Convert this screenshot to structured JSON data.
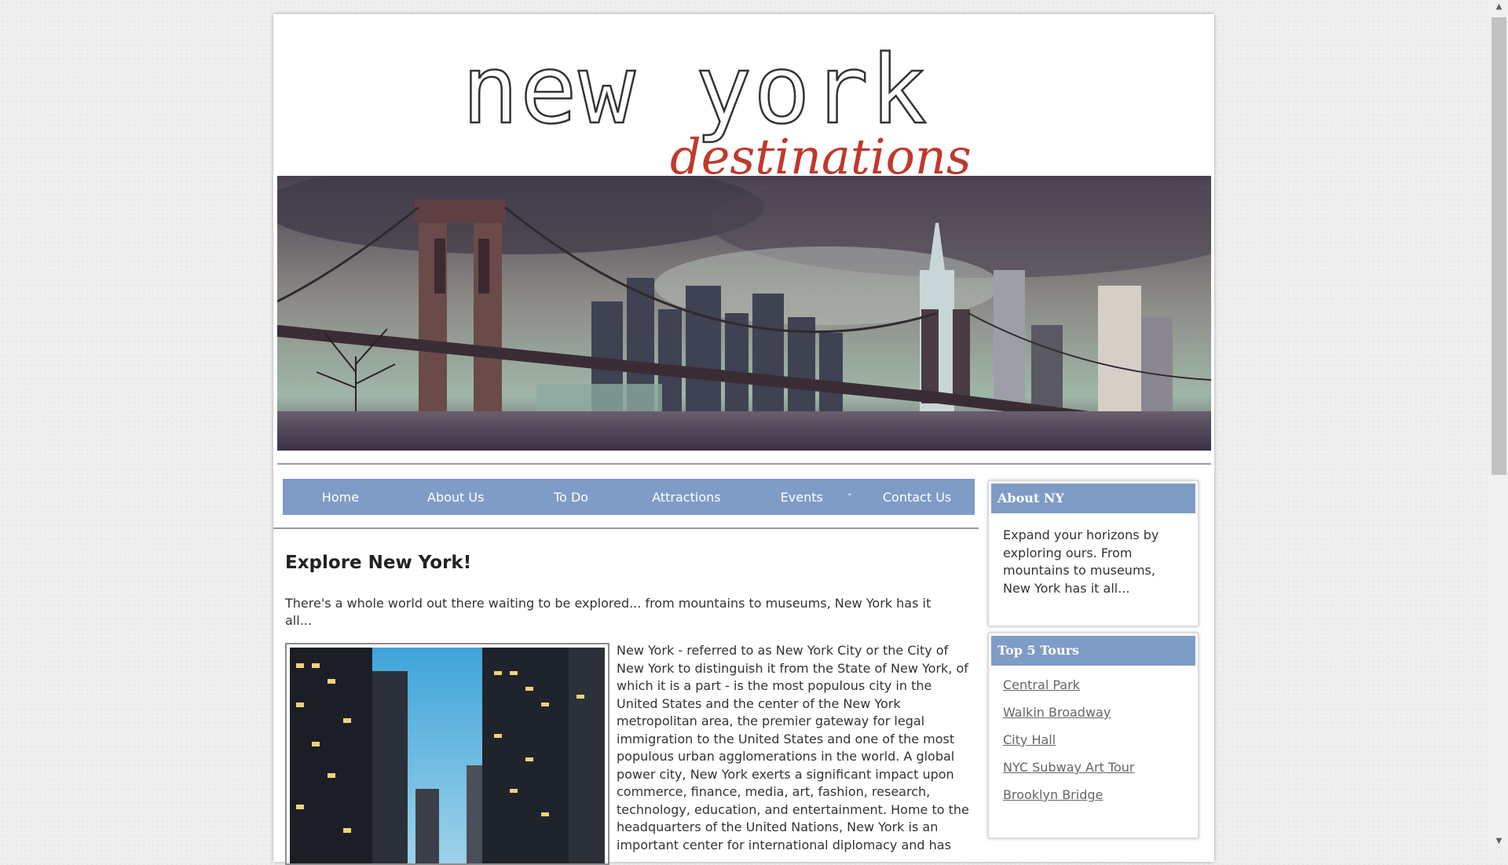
{
  "logo": {
    "line1": "new york",
    "line2": "destinations"
  },
  "nav": {
    "items": [
      "Home",
      "About Us",
      "To Do",
      "Attractions",
      "Events",
      "Contact Us"
    ],
    "events_caret": "-"
  },
  "main": {
    "title": "Explore New York!",
    "intro": "There's a whole world out there waiting to be explored... from mountains to museums, New York has it all...",
    "body": "New York - referred to as New York City or the City of New York to distinguish it from the State of New York, of which it is a part - is the most populous city in the United States and the center of the New York metropolitan area, the premier gateway for legal immigration to the United States and one of the most populous urban agglomerations in the world. A global power city, New York exerts a significant impact upon commerce, finance, media, art, fashion, research, technology, education, and entertainment. Home to the headquarters of the United Nations, New York is an important center for international diplomacy and has"
  },
  "sidebar": {
    "about": {
      "title": "About NY",
      "text": "Expand your horizons by exploring ours.  From mountains to museums, New York has it all..."
    },
    "tours": {
      "title": "Top 5 Tours",
      "items": [
        "Central Park",
        "Walkin Broadway",
        "City Hall",
        "NYC Subway Art Tour",
        "Brooklyn Bridge"
      ]
    }
  },
  "colors": {
    "nav_bg": "#7f9cc6",
    "logo_red": "#c0392b",
    "link": "#666666"
  }
}
